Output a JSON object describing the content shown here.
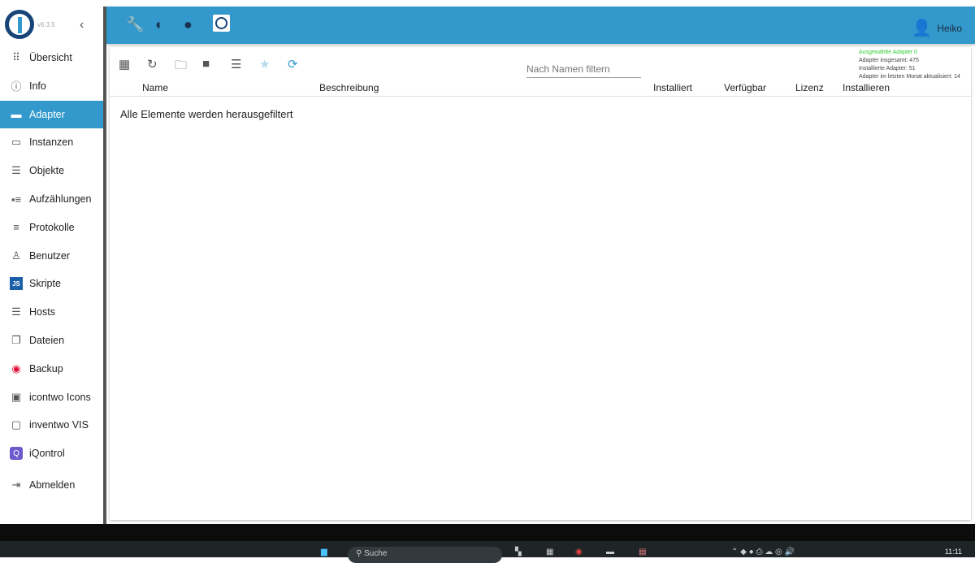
{
  "app": {
    "version": "v6.3.5",
    "user": "Heiko"
  },
  "sidebar": {
    "items": [
      {
        "label": "Übersicht",
        "icon": "grid-icon"
      },
      {
        "label": "Info",
        "icon": "info-icon"
      },
      {
        "label": "Adapter",
        "icon": "store-icon"
      },
      {
        "label": "Instanzen",
        "icon": "instances-icon"
      },
      {
        "label": "Objekte",
        "icon": "list-icon"
      },
      {
        "label": "Aufzählungen",
        "icon": "enum-icon"
      },
      {
        "label": "Protokolle",
        "icon": "log-icon"
      },
      {
        "label": "Benutzer",
        "icon": "user-icon"
      },
      {
        "label": "Skripte",
        "icon": "js-icon"
      },
      {
        "label": "Hosts",
        "icon": "hosts-icon"
      },
      {
        "label": "Dateien",
        "icon": "files-icon"
      },
      {
        "label": "Backup",
        "icon": "backup-icon"
      },
      {
        "label": "icontwo Icons",
        "icon": "icontwo-icon"
      },
      {
        "label": "inventwo VIS",
        "icon": "inventwo-icon"
      },
      {
        "label": "iQontrol",
        "icon": "iqontrol-icon"
      },
      {
        "label": "Abmelden",
        "icon": "logout-icon"
      }
    ]
  },
  "main": {
    "filter_placeholder": "Nach Namen filtern",
    "stats": {
      "selected": "Ausgewählte Adapter 0",
      "total": "Adapter insgesamt: 475",
      "installed": "Installierte Adapter: 51",
      "updated": "Adapter im letzten Monat aktualisiert: 14"
    },
    "columns": [
      "Name",
      "Beschreibung",
      "Installiert",
      "Verfügbar",
      "Lizenz",
      "Installieren"
    ],
    "empty": "Alle Elemente werden herausgefiltert"
  },
  "taskbar": {
    "search": "Suche",
    "time": "11:11"
  }
}
